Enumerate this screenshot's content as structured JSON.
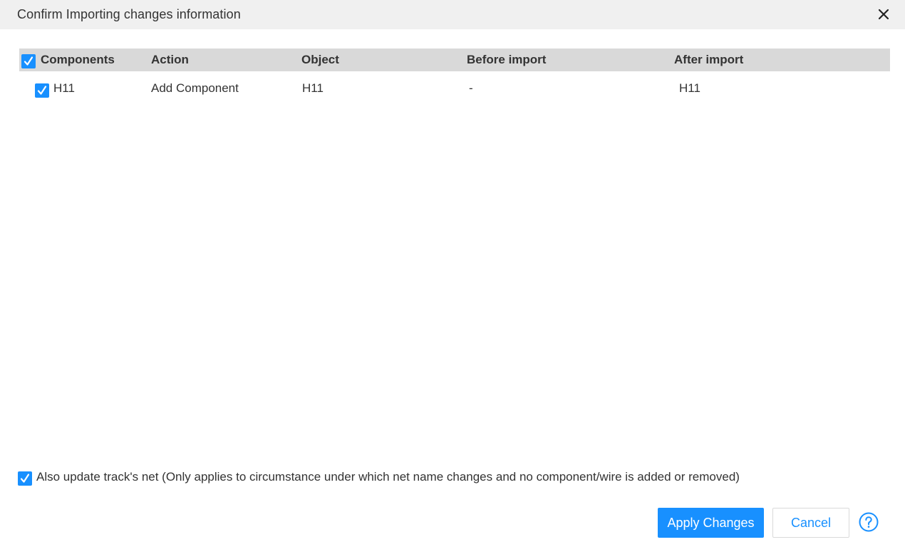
{
  "dialog": {
    "title": "Confirm Importing changes information",
    "close_icon": "close-icon"
  },
  "table": {
    "columns": [
      "Components",
      "Action",
      "Object",
      "Before import",
      "After import"
    ],
    "select_all_checked": true,
    "rows": [
      {
        "checked": true,
        "component": "H11",
        "action": "Add Component",
        "object": "H11",
        "before_import": "-",
        "after_import": "H11"
      }
    ]
  },
  "options": {
    "update_track_net_checked": true,
    "update_track_net_label": "Also update track's net (Only applies to circumstance under which net name changes and no component/wire is added or removed)"
  },
  "footer": {
    "apply_label": "Apply Changes",
    "cancel_label": "Cancel",
    "help_icon": "question-circle-icon"
  },
  "colors": {
    "accent": "#1890ff",
    "header_bg": "#d9d9d9",
    "titlebar_bg": "#f0f0f0",
    "text": "#333333"
  }
}
